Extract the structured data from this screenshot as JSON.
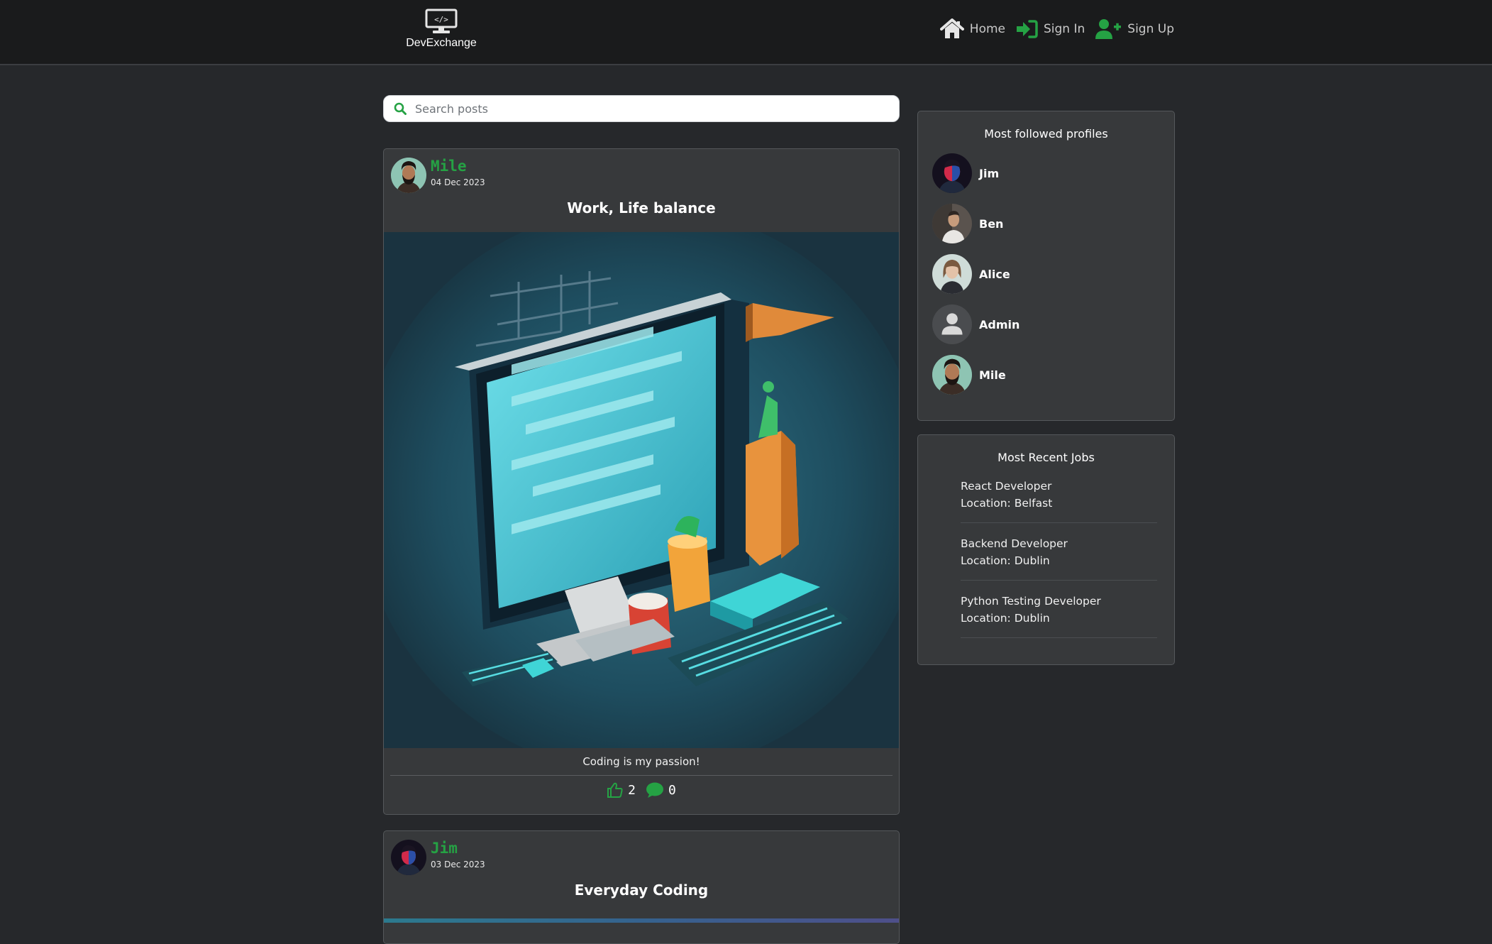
{
  "nav": {
    "brand": "DevExchange",
    "links": [
      {
        "label": "Home",
        "icon": "home-icon"
      },
      {
        "label": "Sign In",
        "icon": "sign-in-icon"
      },
      {
        "label": "Sign Up",
        "icon": "user-plus-icon"
      }
    ]
  },
  "search": {
    "placeholder": "Search posts",
    "value": ""
  },
  "posts": [
    {
      "author": "Mile",
      "date": "04 Dec 2023",
      "title": "Work, Life balance",
      "body": "Coding is my passion!",
      "likes": "2",
      "comments": "0"
    },
    {
      "author": "Jim",
      "date": "03 Dec 2023",
      "title": "Everyday Coding"
    }
  ],
  "profiles": {
    "title": "Most followed profiles",
    "items": [
      {
        "name": "Jim"
      },
      {
        "name": "Ben"
      },
      {
        "name": "Alice"
      },
      {
        "name": "Admin"
      },
      {
        "name": "Mile"
      }
    ]
  },
  "jobs": {
    "title": "Most Recent Jobs",
    "items": [
      {
        "title": "React Developer",
        "location": "Location: Belfast"
      },
      {
        "title": "Backend Developer",
        "location": "Location: Dublin"
      },
      {
        "title": "Python Testing Developer",
        "location": "Location: Dublin"
      }
    ]
  },
  "colors": {
    "accent": "#25a244",
    "background": "#26282b",
    "card": "#37393b",
    "navbar": "#1a1b1c"
  }
}
